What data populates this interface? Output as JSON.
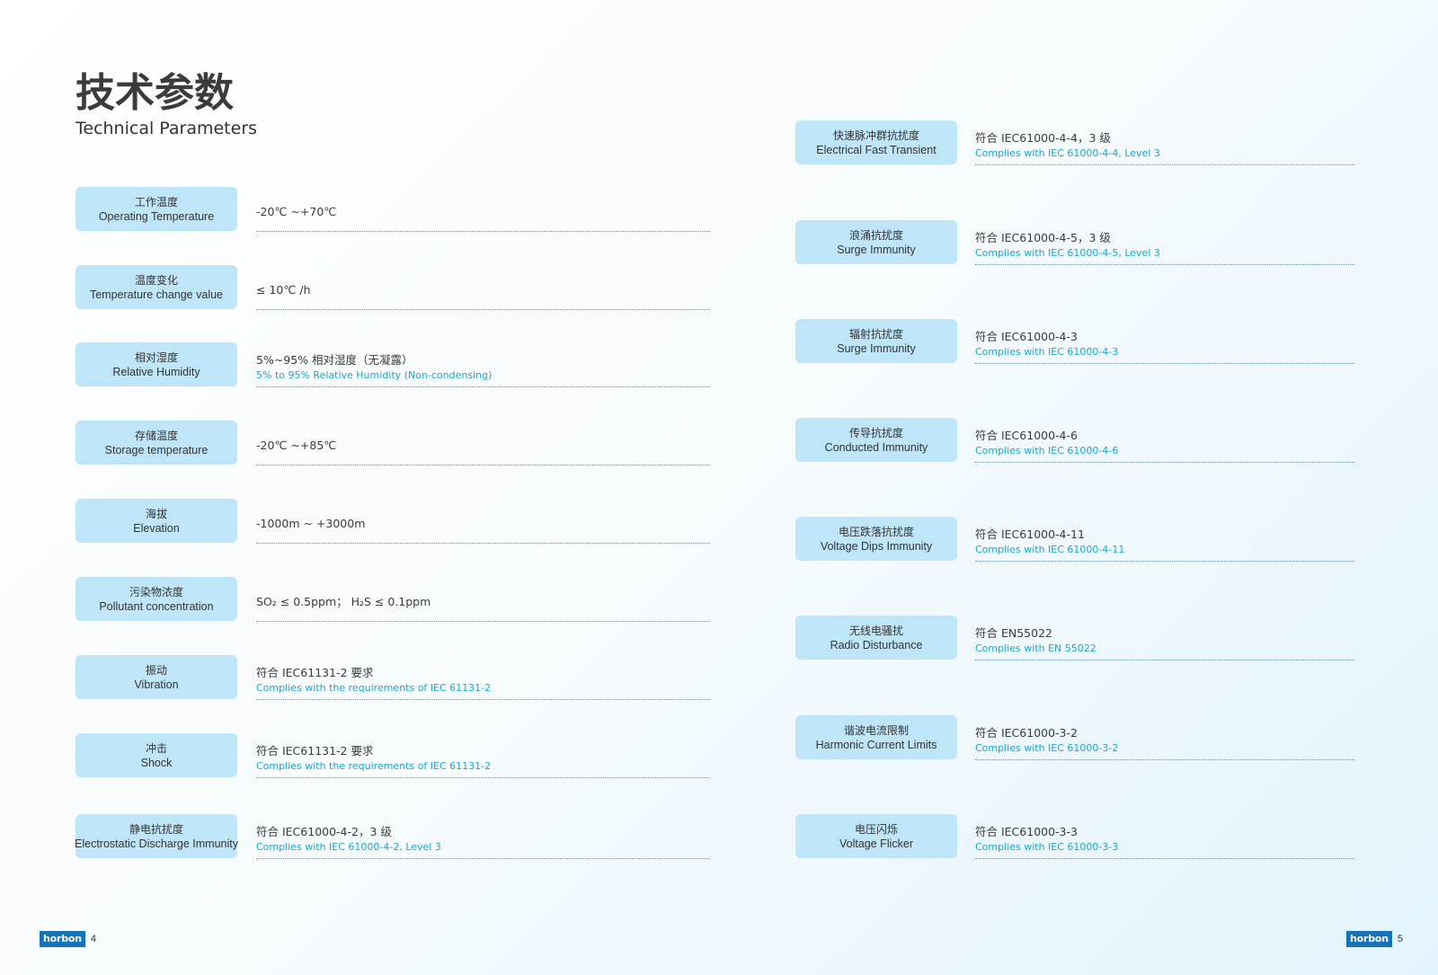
{
  "page": {
    "title_zh": "技术参数",
    "title_en": "Technical Parameters"
  },
  "left": [
    {
      "zh": "工作温度",
      "en": "Operating Temperature",
      "value_zh": "-20℃ ~+70℃",
      "value_en": ""
    },
    {
      "zh": "温度变化",
      "en": "Temperature change value",
      "value_zh": "≤ 10℃ /h",
      "value_en": ""
    },
    {
      "zh": "相对湿度",
      "en": "Relative Humidity",
      "value_zh": "5%~95% 相对湿度（无凝露）",
      "value_en": "5% to 95% Relative Humidity (Non-condensing)"
    },
    {
      "zh": "存储温度",
      "en": "Storage temperature",
      "value_zh": "-20℃ ~+85℃",
      "value_en": ""
    },
    {
      "zh": "海拔",
      "en": "Elevation",
      "value_zh": "-1000m ~ +3000m",
      "value_en": ""
    },
    {
      "zh": "污染物浓度",
      "en": "Pollutant concentration",
      "value_zh": "SO₂ ≤ 0.5ppm； H₂S ≤ 0.1ppm",
      "value_en": ""
    },
    {
      "zh": "振动",
      "en": "Vibration",
      "value_zh": "符合 IEC61131-2 要求",
      "value_en": "Complies with the requirements of IEC 61131-2"
    },
    {
      "zh": "冲击",
      "en": "Shock",
      "value_zh": "符合 IEC61131-2 要求",
      "value_en": "Complies with the requirements of IEC 61131-2"
    },
    {
      "zh": "静电抗扰度",
      "en": "Electrostatic Discharge Immunity",
      "value_zh": "符合 IEC61000-4-2，3 级",
      "value_en": "Complies with IEC 61000-4-2, Level 3"
    }
  ],
  "right": [
    {
      "zh": "快速脉冲群抗扰度",
      "en": "Electrical Fast Transient",
      "value_zh": "符合 IEC61000-4-4，3 级",
      "value_en": "Complies with IEC 61000-4-4, Level 3"
    },
    {
      "zh": "浪涌抗扰度",
      "en": "Surge Immunity",
      "value_zh": "符合 IEC61000-4-5，3 级",
      "value_en": "Complies with IEC 61000-4-5, Level 3"
    },
    {
      "zh": "辐射抗扰度",
      "en": "Surge Immunity",
      "value_zh": "符合 IEC61000-4-3",
      "value_en": "Complies with IEC 61000-4-3"
    },
    {
      "zh": "传导抗扰度",
      "en": "Conducted Immunity",
      "value_zh": "符合 IEC61000-4-6",
      "value_en": "Complies with IEC 61000-4-6"
    },
    {
      "zh": "电压跌落抗扰度",
      "en": "Voltage Dips Immunity",
      "value_zh": "符合 IEC61000-4-11",
      "value_en": "Complies with IEC 61000-4-11"
    },
    {
      "zh": "无线电骚扰",
      "en": "Radio Disturbance",
      "value_zh": "符合 EN55022",
      "value_en": "Complies with EN 55022"
    },
    {
      "zh": "谐波电流限制",
      "en": "Harmonic Current Limits",
      "value_zh": "符合 IEC61000-3-2",
      "value_en": "Complies with IEC 61000-3-2"
    },
    {
      "zh": "电压闪烁",
      "en": "Voltage Flicker",
      "value_zh": "符合 IEC61000-3-3",
      "value_en": "Complies with IEC 61000-3-3"
    }
  ],
  "footer": {
    "brand": "horbon",
    "page_left": "4",
    "page_right": "5"
  },
  "colors": {
    "label_bg": "#bfe5f8",
    "accent_text": "#19a6d6",
    "brand": "#1773b8"
  }
}
